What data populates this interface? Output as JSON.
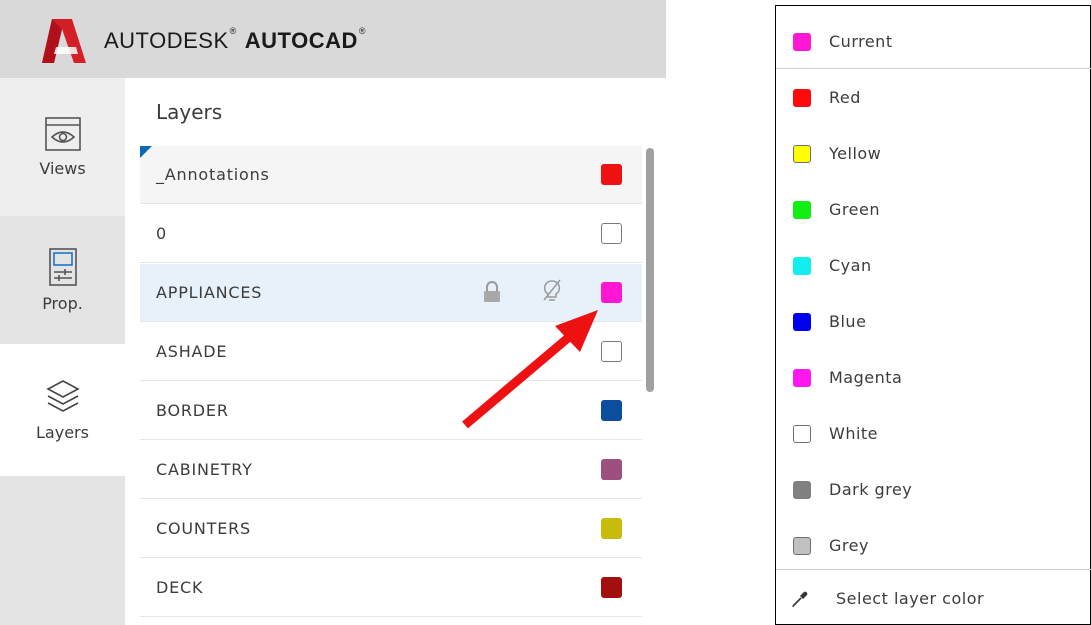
{
  "header": {
    "brand_company": "AUTODESK",
    "brand_product": "AUTOCAD",
    "brand_mark": "®",
    "logo_color": "#d41f28"
  },
  "rail": {
    "items": [
      {
        "label": "Views",
        "icon": "eye-icon"
      },
      {
        "label": "Prop.",
        "icon": "properties-icon"
      },
      {
        "label": "Layers",
        "icon": "layers-icon"
      }
    ],
    "active": "Layers"
  },
  "layers": {
    "title": "Layers",
    "rows": [
      {
        "name": "_Annotations",
        "color": "#ee1111",
        "state": "current"
      },
      {
        "name": "0",
        "color": "#ffffff",
        "state": "normal"
      },
      {
        "name": "APPLIANCES",
        "color": "#ff17d4",
        "state": "selected",
        "icons": [
          "lock-icon",
          "lightbulb-off-icon"
        ]
      },
      {
        "name": "ASHADE",
        "color": "#ffffff",
        "state": "normal"
      },
      {
        "name": "BORDER",
        "color": "#0b4e9e",
        "state": "normal"
      },
      {
        "name": "CABINETRY",
        "color": "#9d4f80",
        "state": "normal"
      },
      {
        "name": "COUNTERS",
        "color": "#c9bb0b",
        "state": "normal"
      },
      {
        "name": "DECK",
        "color": "#a30f0f",
        "state": "normal"
      }
    ]
  },
  "annotation": {
    "arrow_color": "#ee1111"
  },
  "color_menu": {
    "items": [
      {
        "label": "Current",
        "color": "#ff17d4"
      },
      {
        "label": "Red",
        "color": "#ff0a0a"
      },
      {
        "label": "Yellow",
        "color": "#ffff00"
      },
      {
        "label": "Green",
        "color": "#11ee11"
      },
      {
        "label": "Cyan",
        "color": "#11eeee"
      },
      {
        "label": "Blue",
        "color": "#0000ee"
      },
      {
        "label": "Magenta",
        "color": "#ff17ee"
      },
      {
        "label": "White",
        "color": "#ffffff"
      },
      {
        "label": "Dark grey",
        "color": "#808080"
      },
      {
        "label": "Grey",
        "color": "#c0c0c0"
      }
    ],
    "picker_label": "Select layer color",
    "picker_icon": "eyedropper-icon"
  }
}
